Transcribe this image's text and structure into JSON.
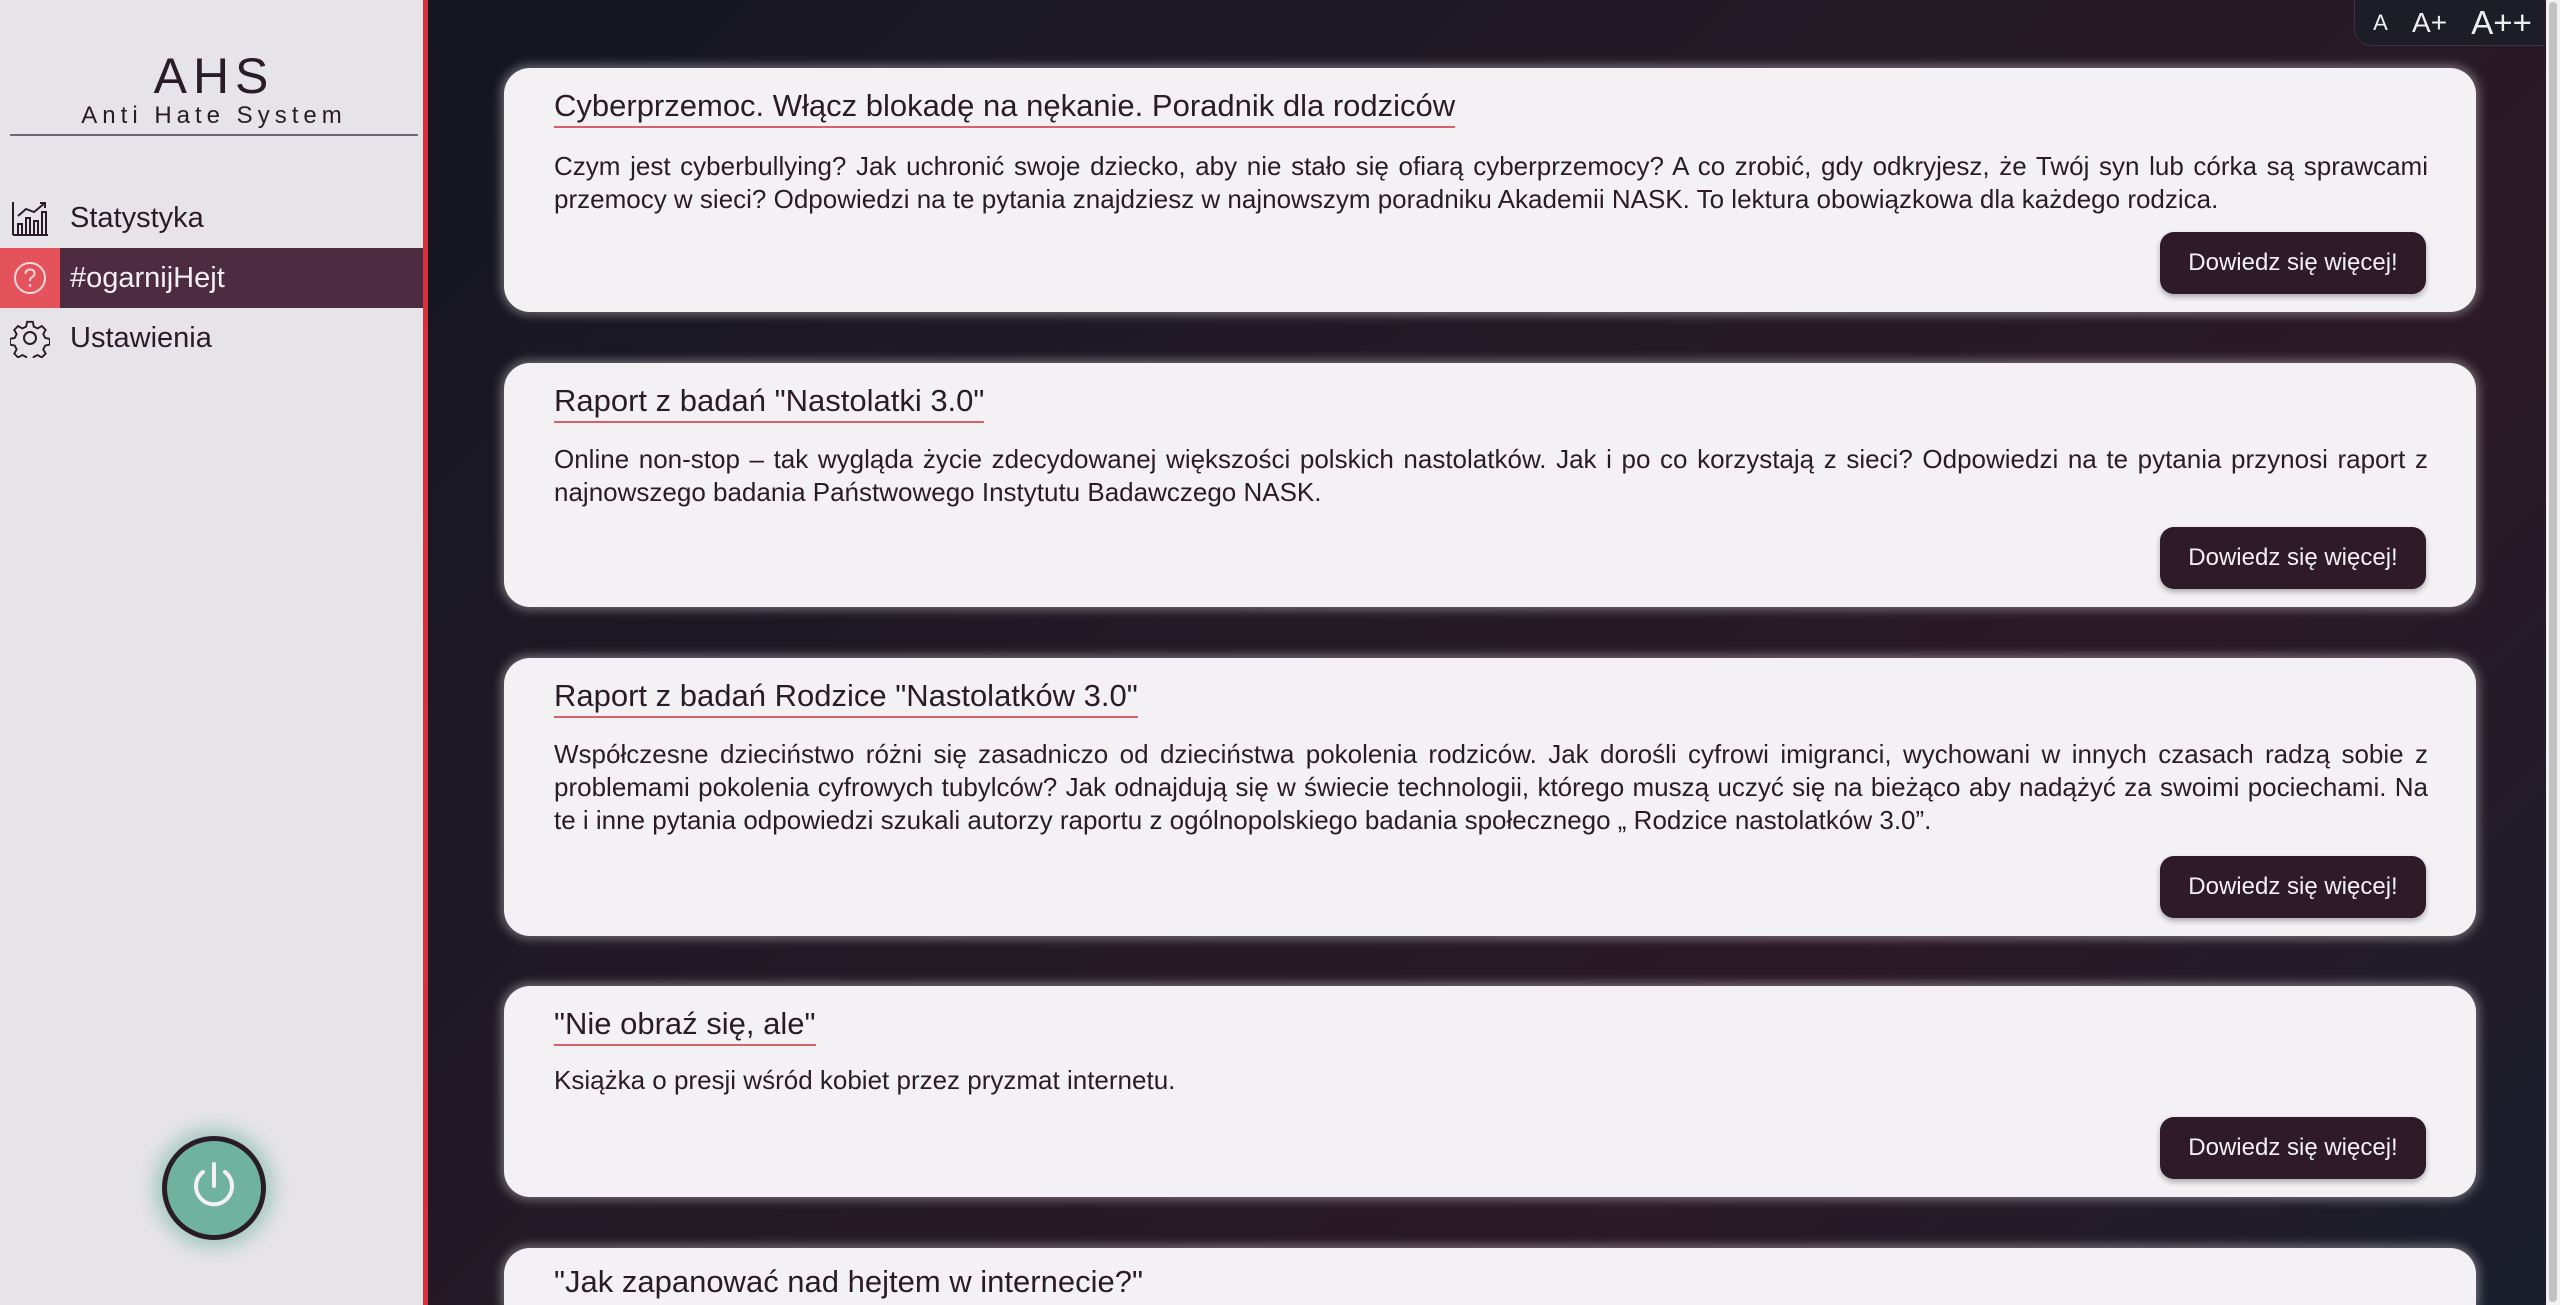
{
  "brand": {
    "title": "AHS",
    "subtitle": "Anti Hate System"
  },
  "sidebar": {
    "items": [
      {
        "label": "Statystyka",
        "icon": "chart-icon",
        "active": false
      },
      {
        "label": "#ogarnijHejt",
        "icon": "help-circle-icon",
        "active": true
      },
      {
        "label": "Ustawienia",
        "icon": "gear-icon",
        "active": false
      }
    ],
    "power_icon": "power-icon"
  },
  "font_controls": {
    "small": "A",
    "medium": "A+",
    "large": "A++"
  },
  "articles": [
    {
      "title": "Cyberprzemoc. Włącz blokadę na nękanie. Poradnik dla rodziców",
      "text": "Czym jest cyberbullying? Jak uchronić swoje dziecko, aby nie stało się ofiarą cyberprzemocy? A co zrobić, gdy odkryjesz, że Twój syn lub córka są sprawcami przemocy w sieci? Odpowiedzi na te pytania znajdziesz w najnowszym poradniku Akademii NASK. To lektura obowiązkowa dla każdego rodzica.",
      "button": "Dowiedz się więcej!"
    },
    {
      "title": "Raport z badań \"Nastolatki 3.0\"",
      "text": "Online non-stop – tak wygląda życie zdecydowanej większości polskich nastolatków. Jak i po co korzystają z sieci? Odpowiedzi na te pytania przynosi raport z najnowszego badania Państwowego Instytutu Badawczego NASK.",
      "button": "Dowiedz się więcej!"
    },
    {
      "title": "Raport z badań Rodzice \"Nastolatków 3.0\"",
      "text": "Współczesne dzieciństwo różni się zasadniczo od dzieciństwa pokolenia rodziców. Jak dorośli cyfrowi imigranci, wychowani w innych czasach radzą sobie z problemami pokolenia cyfrowych tubylców? Jak odnajdują się w świecie technologii, którego muszą uczyć się na bieżąco aby nadążyć za swoimi pociechami. Na te i inne pytania odpowiedzi szukali autorzy raportu z ogólnopolskiego badania społecznego „ Rodzice nastolatków 3.0”.",
      "button": "Dowiedz się więcej!"
    },
    {
      "title": "\"Nie obraź się, ale\"",
      "text": "Książka o presji wśród kobiet przez pryzmat internetu.",
      "button": "Dowiedz się więcej!"
    },
    {
      "title": "\"Jak zapanować nad hejtem w internecie?\"",
      "text": "",
      "button": ""
    }
  ],
  "colors": {
    "accent_red": "#d8333b",
    "active_bg": "#4d2c42",
    "power_green": "#6fb39e",
    "card_bg": "#f3f1f4",
    "button_bg": "#2e1a28"
  }
}
